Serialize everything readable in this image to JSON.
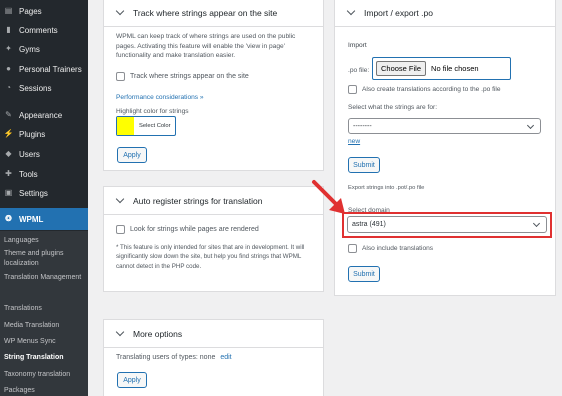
{
  "sidebar": {
    "items": [
      {
        "label": "Pages",
        "icon": "pages-icon"
      },
      {
        "label": "Comments",
        "icon": "comments-icon"
      },
      {
        "label": "Gyms",
        "icon": "pin-icon"
      },
      {
        "label": "Personal Trainers",
        "icon": "person-icon"
      },
      {
        "label": "Sessions",
        "icon": "clock-icon"
      },
      {
        "label": "Appearance",
        "icon": "brush-icon"
      },
      {
        "label": "Plugins",
        "icon": "plug-icon"
      },
      {
        "label": "Users",
        "icon": "user-icon"
      },
      {
        "label": "Tools",
        "icon": "wrench-icon"
      },
      {
        "label": "Settings",
        "icon": "settings-icon"
      },
      {
        "label": "WPML",
        "icon": "wpml-icon"
      }
    ],
    "submenu": [
      "Languages",
      "Theme and plugins localization",
      "Translation Management",
      "Translations",
      "Media Translation",
      "WP Menus Sync",
      "String Translation",
      "Taxonomy translation",
      "Packages"
    ],
    "current_submenu": "String Translation",
    "accent": "#2271b1"
  },
  "track_panel": {
    "title": "Track where strings appear on the site",
    "description": "WPML can keep track of where strings are used on the public pages. Activating this feature will enable the 'view in page' functionality and make translation easier.",
    "checkbox_label": "Track where strings appear on the site",
    "perf_link": "Performance considerations »",
    "highlight_label": "Highlight color for strings",
    "swatch_color": "#ffff00",
    "select_color_label": "Select Color",
    "apply_label": "Apply"
  },
  "auto_panel": {
    "title": "Auto register strings for translation",
    "checkbox_label": "Look for strings while pages are rendered",
    "note": "* This feature is only intended for sites that are in development. It will significantly slow down the site, but help you find strings that WPML cannot detect in the PHP code."
  },
  "more_panel": {
    "title": "More options",
    "translating_text": "Translating users of types: none",
    "edit_link": "edit",
    "apply_label": "Apply"
  },
  "import_panel": {
    "title": "Import / export .po",
    "import_heading": "Import",
    "po_file_label": ".po file:",
    "choose_file_label": "Choose File",
    "no_file_text": "No file chosen",
    "create_translations_label": "Also create translations according to the .po file",
    "strings_for_label": "Select what the strings are for:",
    "strings_for_value": "--------",
    "new_link": "new",
    "submit_label": "Submit",
    "export_heading": "Export strings into .pot/.po file",
    "select_domain_label": "Select domain",
    "domain_value": "astra (491)",
    "include_translations_label": "Also include translations",
    "submit2_label": "Submit",
    "highlight_color": "#e03131"
  }
}
